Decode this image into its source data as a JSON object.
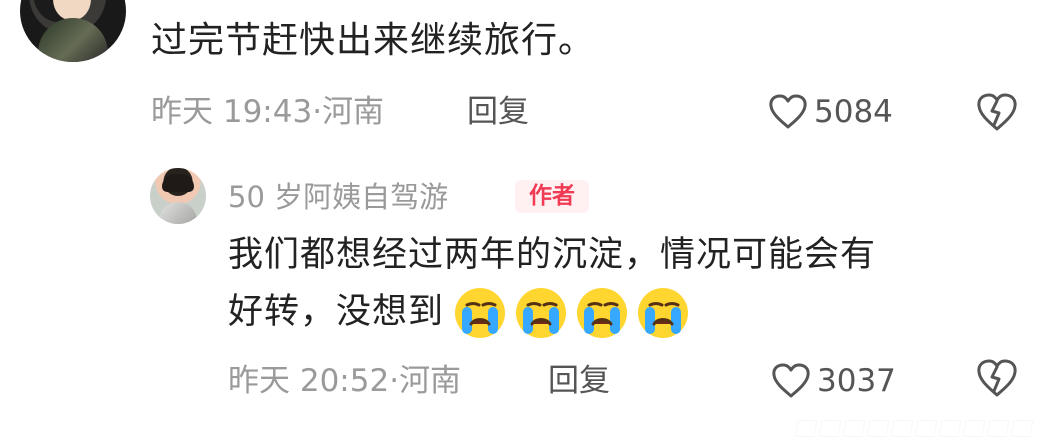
{
  "comment": {
    "text": "过完节赶快出来继续旅行。",
    "time": "昨天 19:43",
    "separator": "·",
    "location": "河南",
    "reply_label": "回复",
    "likes": "5084"
  },
  "reply": {
    "author": "50 岁阿姨自驾游",
    "badge": "作者",
    "text_line_1": "我们都想经过两年的沉淀，情况可能会有",
    "text_line_2": "好转，没想到",
    "emoji": "crying-face-icon",
    "time": "昨天 20:52",
    "separator": "·",
    "location": "河南",
    "reply_label": "回复",
    "likes": "3037"
  },
  "icons": {
    "like": "heart-outline-icon",
    "dislike": "broken-heart-icon"
  },
  "colors": {
    "text": "#222222",
    "meta": "#9a9a9a",
    "author_badge_text": "#f13b55",
    "author_badge_bg": "#fff0f2"
  }
}
